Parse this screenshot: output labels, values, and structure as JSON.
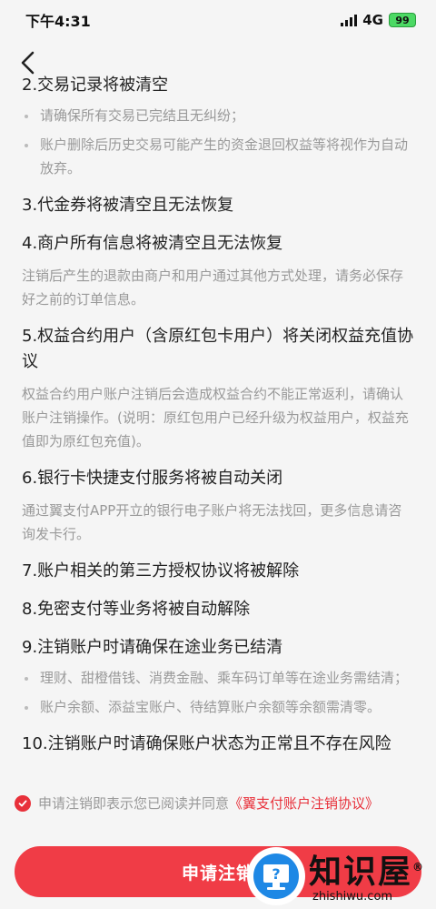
{
  "status": {
    "time": "下午4:31",
    "network": "4G",
    "battery": "99"
  },
  "sections": [
    {
      "kind": "h",
      "text": "2.交易记录将被清空"
    },
    {
      "kind": "bullet",
      "text": "请确保所有交易已完结且无纠纷；"
    },
    {
      "kind": "bullet",
      "text": "账户删除后历史交易可能产生的资金退回权益等将视作为自动放弃。"
    },
    {
      "kind": "h",
      "text": "3.代金券将被清空且无法恢复"
    },
    {
      "kind": "h",
      "text": "4.商户所有信息将被清空且无法恢复"
    },
    {
      "kind": "sub",
      "text": "注销后产生的退款由商户和用户通过其他方式处理，请务必保存好之前的订单信息。"
    },
    {
      "kind": "h",
      "text": "5.权益合约用户（含原红包卡用户）将关闭权益充值协议"
    },
    {
      "kind": "sub",
      "text": "权益合约用户账户注销后会造成权益合约不能正常返利，请确认账户注销操作。(说明：原红包用户已经升级为权益用户，权益充值即为原红包充值)。"
    },
    {
      "kind": "h",
      "text": "6.银行卡快捷支付服务将被自动关闭"
    },
    {
      "kind": "sub",
      "text": "通过翼支付APP开立的银行电子账户将无法找回，更多信息请咨询发卡行。"
    },
    {
      "kind": "h",
      "text": "7.账户相关的第三方授权协议将被解除"
    },
    {
      "kind": "h",
      "text": "8.免密支付等业务将被自动解除"
    },
    {
      "kind": "h",
      "text": "9.注销账户时请确保在途业务已结清"
    },
    {
      "kind": "bullet",
      "text": "理财、甜橙借钱、消费金融、乘车码订单等在途业务需结清；"
    },
    {
      "kind": "bullet",
      "text": "账户余额、添益宝账户、待结算账户余额等余额需清零。"
    },
    {
      "kind": "h",
      "text": "10.注销账户时请确保账户状态为正常且不存在风险"
    }
  ],
  "agreement": {
    "prefix": "申请注销即表示您已阅读并同意",
    "link": "《翼支付账户注销协议》",
    "checked": true
  },
  "apply_button": "申请注销",
  "watermark": {
    "cn": "知识屋",
    "en": "zhishiwu.com",
    "mark": "®"
  },
  "colors": {
    "accent": "#f03c46",
    "muted": "#999999",
    "text": "#222222"
  }
}
